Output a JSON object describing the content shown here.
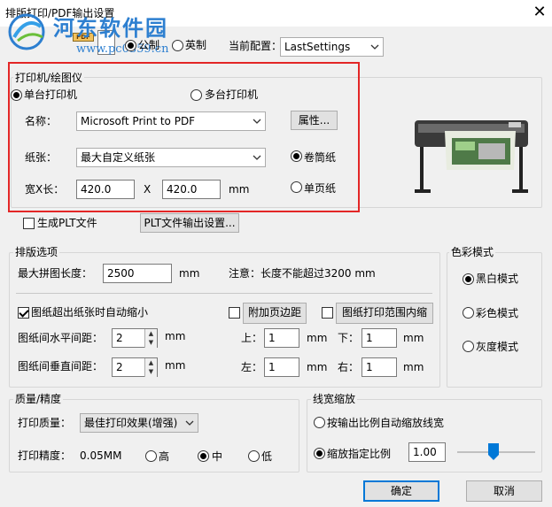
{
  "window": {
    "title": "排版打印/PDF输出设置"
  },
  "watermark": {
    "text": "河东软件园",
    "url": "www.pc0359.cn"
  },
  "pdf_badge": "PDF",
  "units": {
    "metric": "公制",
    "imperial": "英制"
  },
  "current_config": {
    "label": "当前配置：",
    "value": "LastSettings"
  },
  "printer_group": {
    "title": "打印机/绘图仪",
    "single": "单台打印机",
    "multi": "多台打印机",
    "name_label": "名称：",
    "name_value": "Microsoft Print to PDF",
    "properties_button": "属性...",
    "paper_label": "纸张：",
    "paper_value": "最大自定义纸张",
    "roll": "卷筒纸",
    "size_label": "宽X长：",
    "width": "420.0",
    "x": "X",
    "length": "420.0",
    "unit": "mm",
    "sheet": "单页纸"
  },
  "plt": {
    "checkbox": "生成PLT文件",
    "button": "PLT文件输出设置..."
  },
  "layout_group": {
    "title": "排版选项",
    "max_len_label": "最大拼图长度：",
    "max_len_value": "2500",
    "unit": "mm",
    "note": "注意：长度不能超过3200 mm",
    "autoscale": "图纸超出纸张时自动缩小",
    "h_gap_label": "图纸间水平间距：",
    "h_gap_value": "2",
    "v_gap_label": "图纸间垂直间距：",
    "v_gap_value": "2",
    "margin_button": "附加页边距",
    "in_range_button": "图纸打印范围内缩",
    "top_label": "上：",
    "top_value": "1",
    "bottom_label": "下：",
    "bottom_value": "1",
    "left_label": "左：",
    "left_value": "1",
    "right_label": "右：",
    "right_value": "1"
  },
  "color_group": {
    "title": "色彩模式",
    "bw": "黑白模式",
    "color": "彩色模式",
    "gray": "灰度模式"
  },
  "quality_group": {
    "title": "质量/精度",
    "quality_label": "打印质量：",
    "quality_value": "最佳打印效果(增强)",
    "precision_label": "打印精度：",
    "precision_value": "0.05MM",
    "high": "高",
    "mid": "中",
    "low": "低"
  },
  "linewidth_group": {
    "title": "线宽缩放",
    "auto": "按输出比例自动缩放线宽",
    "specified": "缩放指定比例",
    "ratio": "1.00"
  },
  "buttons": {
    "ok": "确定",
    "cancel": "取消"
  },
  "colors": {
    "accent": "#0078d7",
    "highlight": "#e32626",
    "watermark": "#2d7fd0"
  }
}
